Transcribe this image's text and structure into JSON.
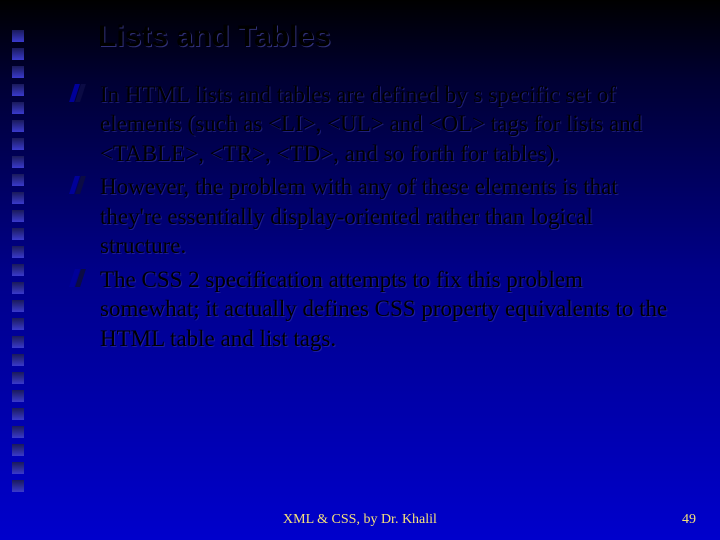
{
  "title": "Lists and Tables",
  "bullets": [
    "In HTML lists and tables are defined by s specific set of elements (such as <LI>, <UL> and <OL> tags for lists and <TABLE>, <TR>, <TD>, and so forth for tables).",
    "However, the problem with any of these elements is that they're essentially display-oriented rather than logical structure.",
    "The CSS 2 specification attempts to fix this problem somewhat; it actually defines CSS property equivalents to the HTML table and list tags."
  ],
  "footer": "XML & CSS, by Dr. Khalil",
  "page_number": "49"
}
